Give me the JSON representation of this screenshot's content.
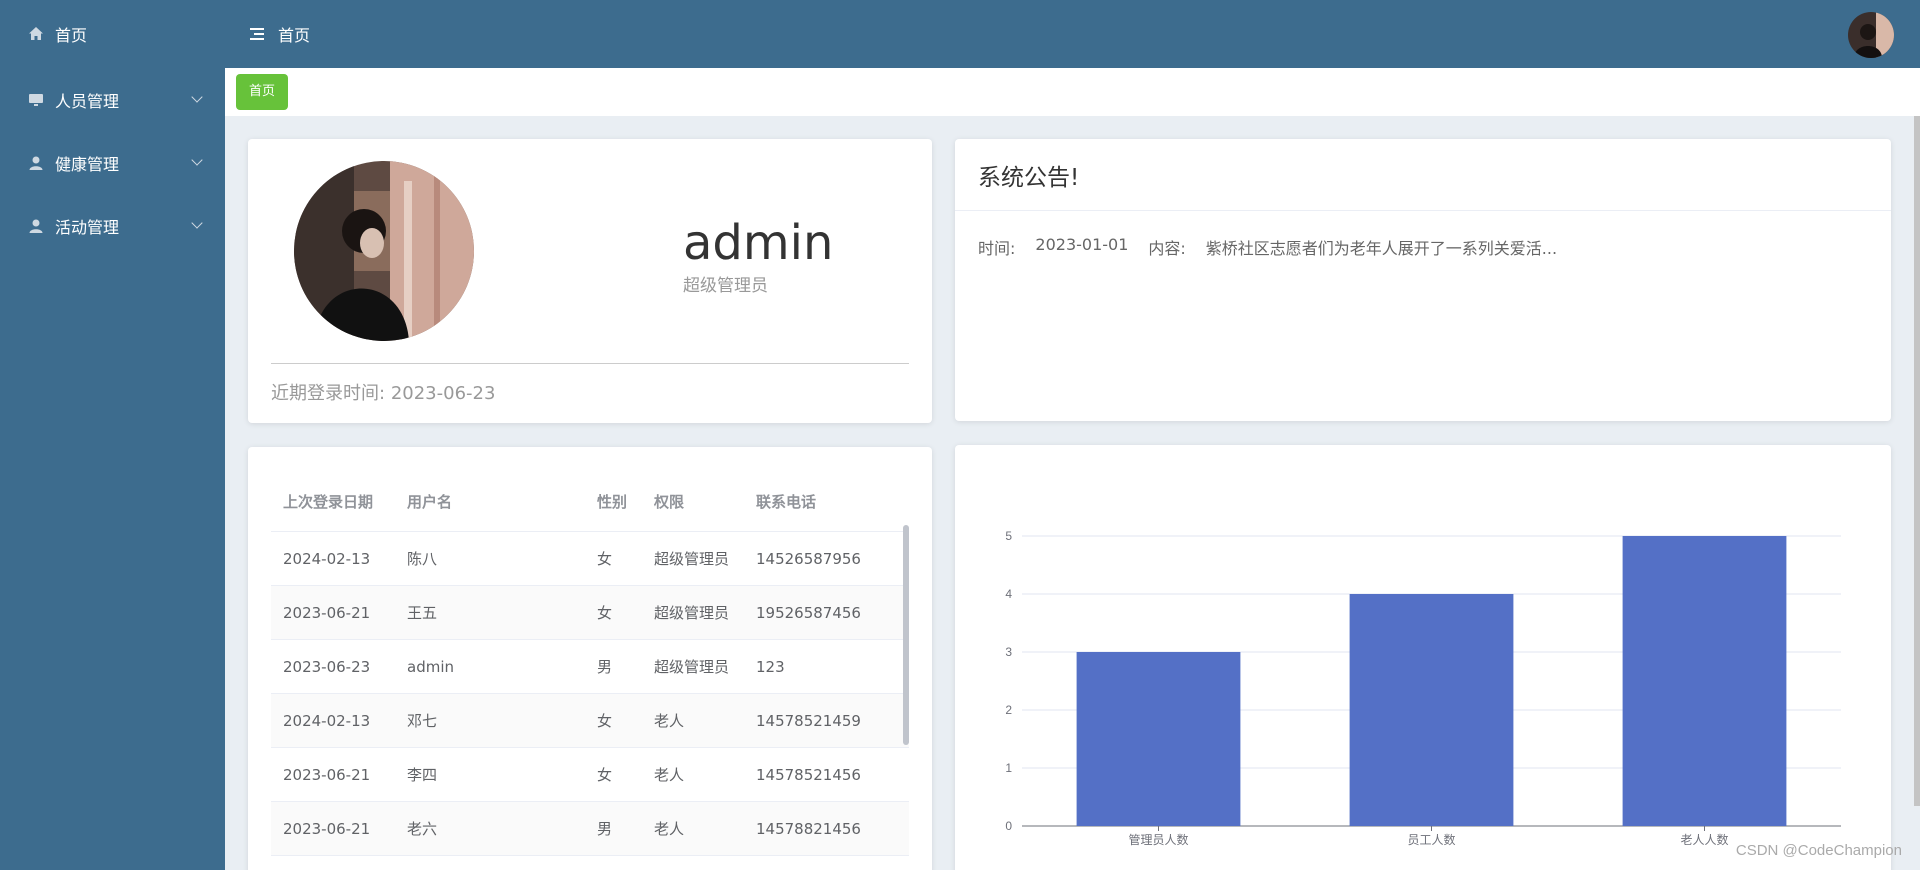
{
  "sidebar": {
    "items": [
      {
        "label": "首页",
        "icon": "home-icon",
        "has_submenu": false
      },
      {
        "label": "人员管理",
        "icon": "monitor-icon",
        "has_submenu": true
      },
      {
        "label": "健康管理",
        "icon": "user-icon",
        "has_submenu": true
      },
      {
        "label": "活动管理",
        "icon": "user-icon",
        "has_submenu": true
      }
    ]
  },
  "header": {
    "title": "首页",
    "menu_icon": "hamburger-icon"
  },
  "tags": {
    "active": "首页"
  },
  "user_card": {
    "name": "admin",
    "role": "超级管理员",
    "login_label": "近期登录时间:",
    "login_date": "2023-06-23"
  },
  "notice": {
    "title": "系统公告!",
    "time_label": "时间:",
    "time": "2023-01-01",
    "content_label": "内容:",
    "content": "紫桥社区志愿者们为老年人展开了一系列关爱活..."
  },
  "table": {
    "headers": [
      "上次登录日期",
      "用户名",
      "性别",
      "权限",
      "联系电话"
    ],
    "rows": [
      [
        "2024-02-13",
        "陈八",
        "女",
        "超级管理员",
        "14526587956"
      ],
      [
        "2023-06-21",
        "王五",
        "女",
        "超级管理员",
        "19526587456"
      ],
      [
        "2023-06-23",
        "admin",
        "男",
        "超级管理员",
        "123"
      ],
      [
        "2024-02-13",
        "邓七",
        "女",
        "老人",
        "14578521459"
      ],
      [
        "2023-06-21",
        "李四",
        "女",
        "老人",
        "14578521456"
      ],
      [
        "2023-06-21",
        "老六",
        "男",
        "老人",
        "14578821456"
      ]
    ]
  },
  "chart_data": {
    "type": "bar",
    "categories": [
      "管理员人数",
      "员工人数",
      "老人人数"
    ],
    "values": [
      3,
      4,
      5
    ],
    "ylim": [
      0,
      5
    ],
    "yticks": [
      0,
      1,
      2,
      3,
      4,
      5
    ],
    "bar_color": "#5470c6",
    "grid": true,
    "title": "",
    "xlabel": "",
    "ylabel": ""
  },
  "watermark": "CSDN @CodeChampion",
  "colors": {
    "sidebar": "#3d6c8e",
    "tag": "#67c23a",
    "bar": "#5470c6"
  }
}
